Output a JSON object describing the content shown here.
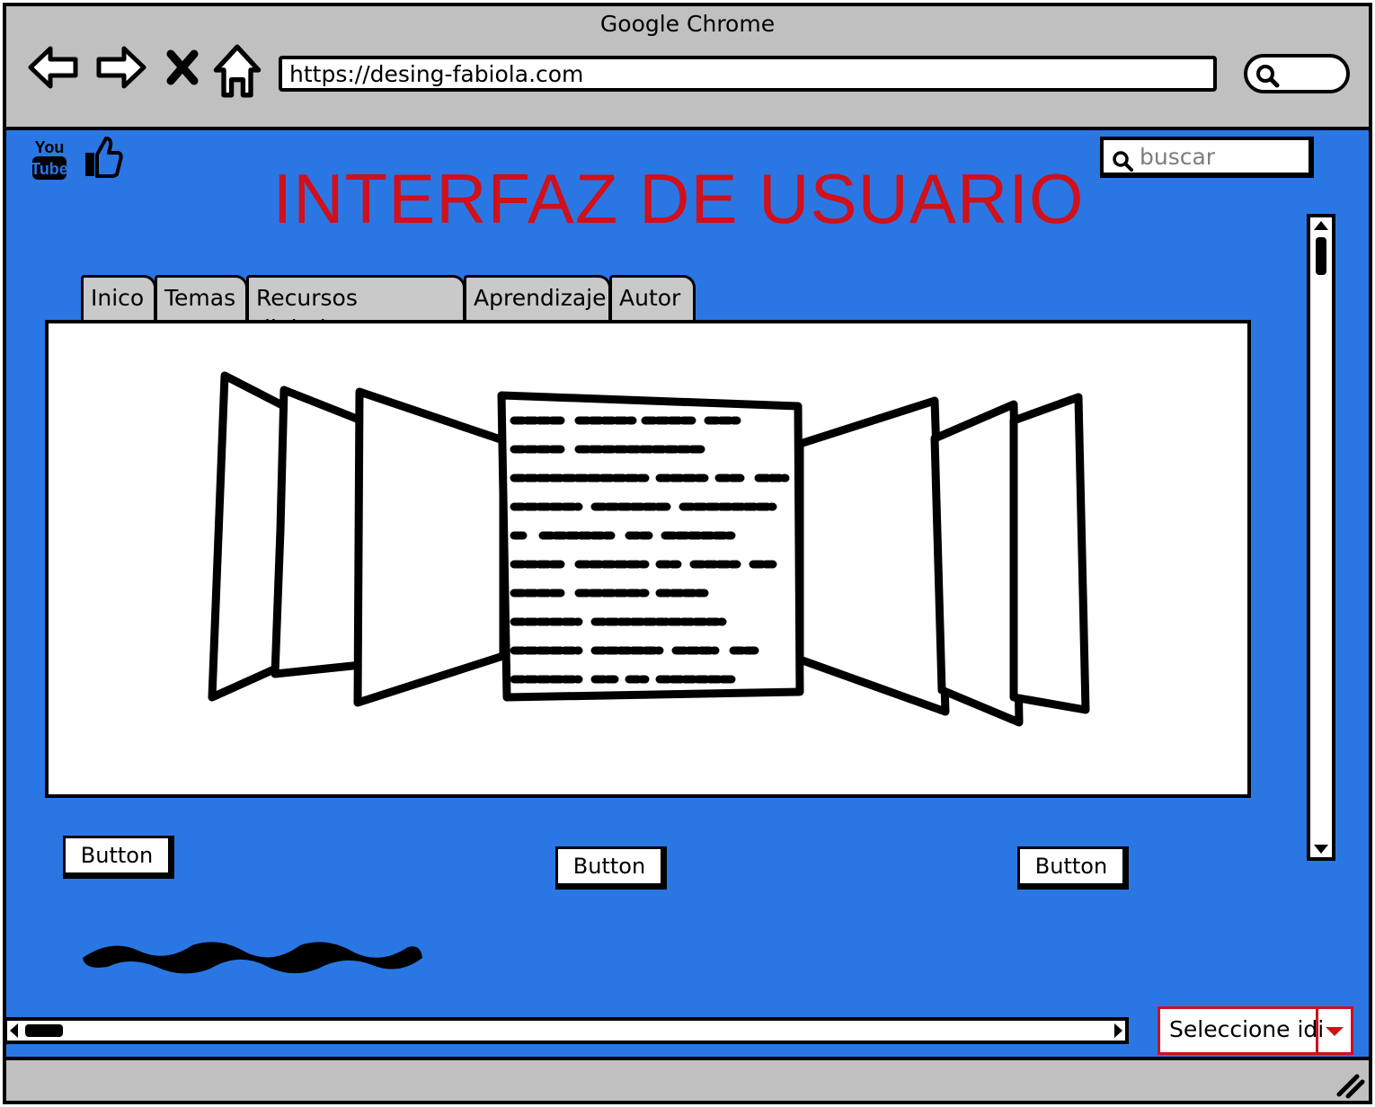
{
  "browser": {
    "window_title": "Google Chrome",
    "url": "https://desing-fabiola.com"
  },
  "page": {
    "title": "INTERFAZ DE USUARIO",
    "search_placeholder": "buscar",
    "language_select_value": "Seleccione idi",
    "accent_color": "#d0101a",
    "background_color": "#2a77e4"
  },
  "social": {
    "youtube_top": "You",
    "youtube_bottom": "Tube",
    "icons": [
      "youtube-icon",
      "thumbs-up-icon"
    ]
  },
  "tabs": [
    {
      "label": "Inico"
    },
    {
      "label": "Temas"
    },
    {
      "label": "Recursos digitales"
    },
    {
      "label": "Aprendizaje"
    },
    {
      "label": "Autor"
    }
  ],
  "buttons": [
    {
      "label": "Button"
    },
    {
      "label": "Button"
    },
    {
      "label": "Button"
    }
  ]
}
